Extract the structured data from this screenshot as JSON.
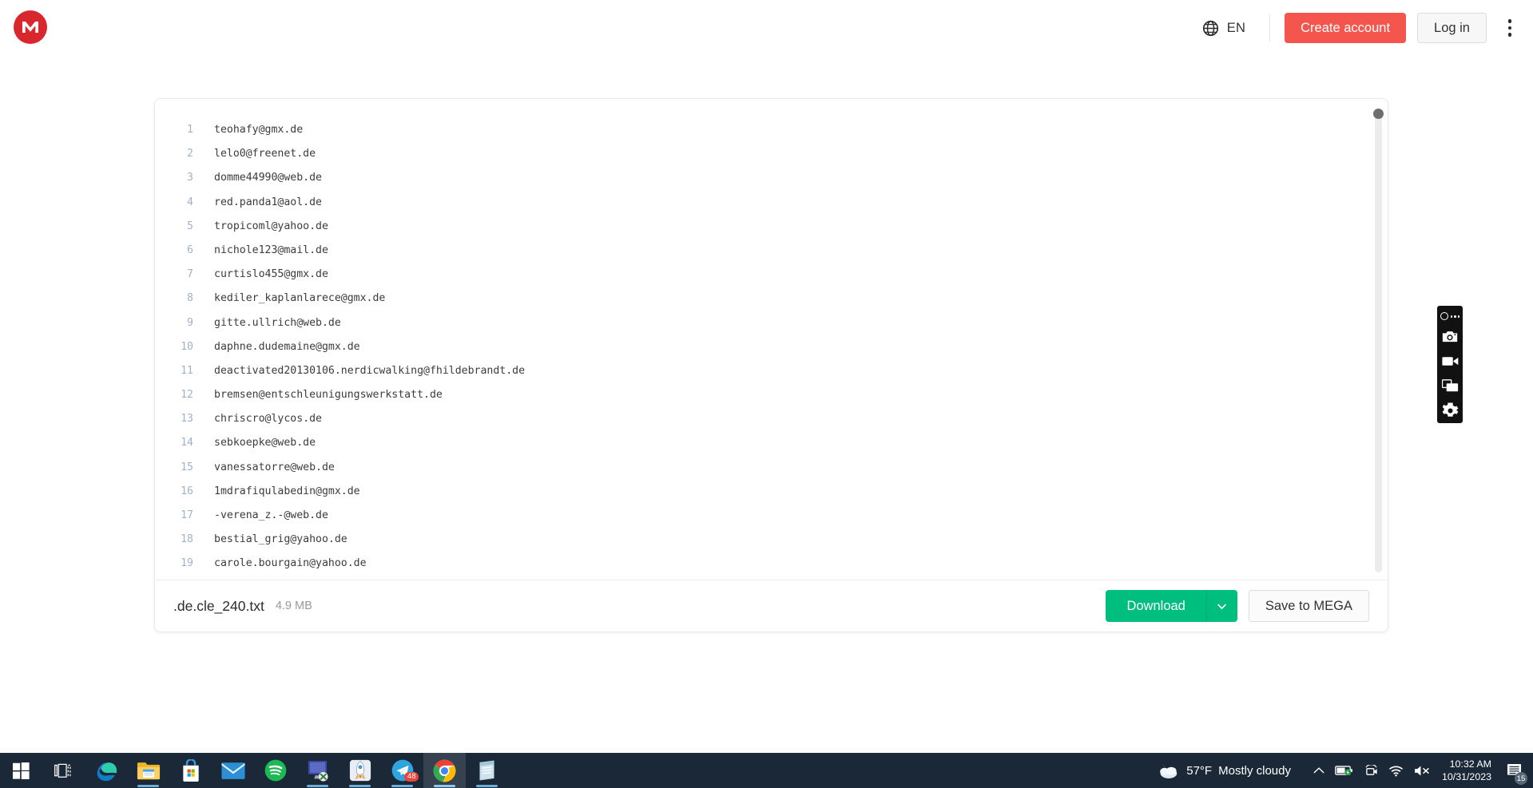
{
  "header": {
    "logo_alt": "MEGA",
    "language": "EN",
    "create_account_label": "Create account",
    "login_label": "Log in"
  },
  "file_preview": {
    "lines": [
      {
        "num": "1",
        "text": "teohafy@gmx.de"
      },
      {
        "num": "2",
        "text": "lelo0@freenet.de"
      },
      {
        "num": "3",
        "text": "domme44990@web.de"
      },
      {
        "num": "4",
        "text": "red.panda1@aol.de"
      },
      {
        "num": "5",
        "text": "tropicoml@yahoo.de"
      },
      {
        "num": "6",
        "text": "nichole123@mail.de"
      },
      {
        "num": "7",
        "text": "curtislo455@gmx.de"
      },
      {
        "num": "8",
        "text": "kediler_kaplanlarece@gmx.de"
      },
      {
        "num": "9",
        "text": "gitte.ullrich@web.de"
      },
      {
        "num": "10",
        "text": "daphne.dudemaine@gmx.de"
      },
      {
        "num": "11",
        "text": "deactivated20130106.nerdicwalking@fhildebrandt.de"
      },
      {
        "num": "12",
        "text": "bremsen@entschleunigungswerkstatt.de"
      },
      {
        "num": "13",
        "text": "chriscro@lycos.de"
      },
      {
        "num": "14",
        "text": "sebkoepke@web.de"
      },
      {
        "num": "15",
        "text": "vanessatorre@web.de"
      },
      {
        "num": "16",
        "text": "1mdrafiqulabedin@gmx.de"
      },
      {
        "num": "17",
        "text": "-verena_z.-@web.de"
      },
      {
        "num": "18",
        "text": "bestial_grig@yahoo.de"
      },
      {
        "num": "19",
        "text": "carole.bourgain@yahoo.de"
      }
    ]
  },
  "footer": {
    "file_name": ".de.cle_240.txt",
    "file_size": "4.9 MB",
    "download_label": "Download",
    "save_label": "Save to MEGA"
  },
  "recorder_toolbar": {
    "items": [
      "screenshot",
      "record-video",
      "capture-window",
      "settings"
    ]
  },
  "taskbar": {
    "apps": [
      {
        "name": "start",
        "label": "Start"
      },
      {
        "name": "task-view",
        "label": "Task View"
      },
      {
        "name": "microsoft-edge",
        "label": "Microsoft Edge"
      },
      {
        "name": "file-explorer",
        "label": "File Explorer"
      },
      {
        "name": "microsoft-store",
        "label": "Microsoft Store"
      },
      {
        "name": "mail",
        "label": "Mail"
      },
      {
        "name": "spotify",
        "label": "Spotify"
      },
      {
        "name": "virtual-machine",
        "label": "Virtual Machine"
      },
      {
        "name": "pycharm",
        "label": "PyCharm"
      },
      {
        "name": "telegram",
        "label": "Telegram",
        "badge": "48"
      },
      {
        "name": "google-chrome",
        "label": "Google Chrome",
        "active": true
      },
      {
        "name": "notepad",
        "label": "Notepad"
      }
    ],
    "weather": {
      "temperature": "57°F",
      "condition": "Mostly cloudy"
    },
    "clock": {
      "time": "10:32 AM",
      "date": "10/31/2023"
    },
    "notification_count": "15"
  },
  "colors": {
    "mega_red": "#d9272e",
    "create_account_red": "#f4564d",
    "download_green": "#00bf7e",
    "line_number": "#9fb3c8",
    "taskbar": "#1b2838"
  }
}
